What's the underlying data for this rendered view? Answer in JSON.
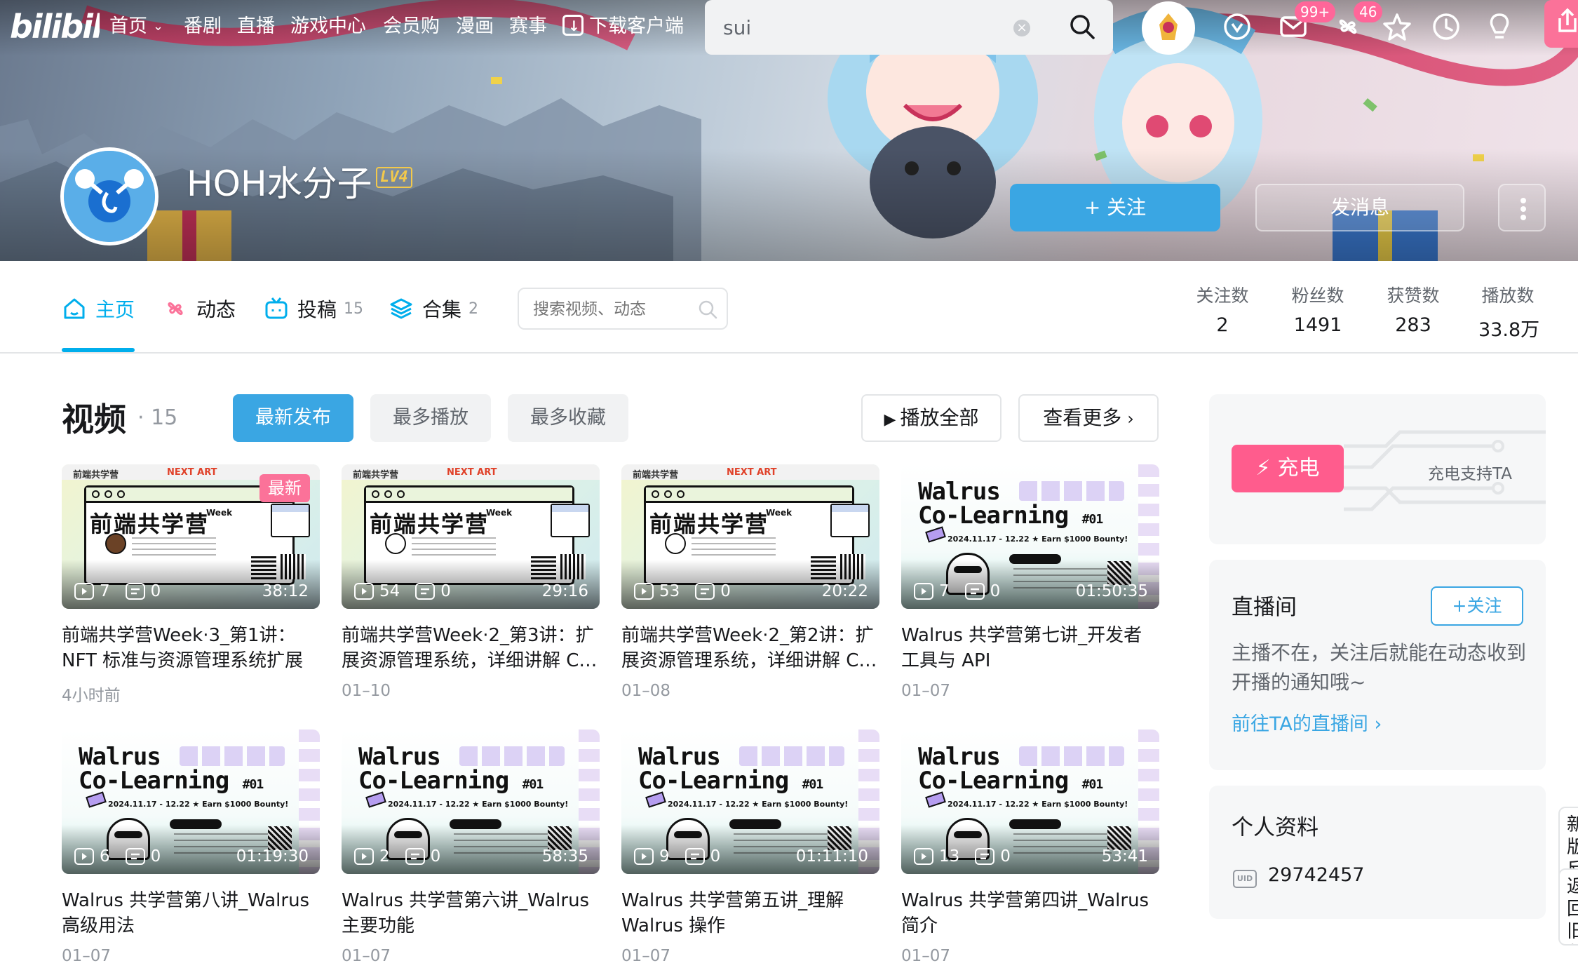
{
  "nav": {
    "logo": "bilibili",
    "items": [
      "首页",
      "番剧",
      "直播",
      "游戏中心",
      "会员购",
      "漫画",
      "赛事"
    ],
    "download": "下载客户端",
    "search_value": "sui",
    "badges": {
      "messages": "99+",
      "dynamic": "46"
    }
  },
  "profile": {
    "name": "HOH水分子",
    "level": "LV4",
    "follow_label": "+ 关注",
    "message_label": "发消息"
  },
  "tabs": {
    "home": "主页",
    "dynamic": "动态",
    "videos": "投稿",
    "videos_count": "15",
    "collections": "合集",
    "collections_count": "2",
    "search_placeholder": "搜索视频、动态"
  },
  "stats": [
    {
      "label": "关注数",
      "value": "2"
    },
    {
      "label": "粉丝数",
      "value": "1491"
    },
    {
      "label": "获赞数",
      "value": "283"
    },
    {
      "label": "播放数",
      "value": "33.8万"
    }
  ],
  "videos_section": {
    "title": "视频",
    "count": "· 15",
    "sort_latest": "最新发布",
    "sort_most_played": "最多播放",
    "sort_most_fav": "最多收藏",
    "play_all": "播放全部",
    "see_more": "查看更多"
  },
  "videos": [
    {
      "title": "前端共学营Week·3_第1讲：NFT 标准与资源管理系统扩展",
      "date": "4小时前",
      "plays": "7",
      "danmaku": "0",
      "duration": "38:12",
      "tag": "最新",
      "thumb_title": "前端共学营"
    },
    {
      "title": "前端共学营Week·2_第3讲：扩展资源管理系统，详细讲解 C…",
      "date": "01–10",
      "plays": "54",
      "danmaku": "0",
      "duration": "29:16",
      "thumb_title": "前端共学营"
    },
    {
      "title": "前端共学营Week·2_第2讲：扩展资源管理系统，详细讲解 C…",
      "date": "01–08",
      "plays": "53",
      "danmaku": "0",
      "duration": "20:22",
      "thumb_title": "前端共学营"
    },
    {
      "title": "Walrus 共学营第七讲_开发者工具与 API",
      "date": "01–07",
      "plays": "7",
      "danmaku": "0",
      "duration": "01:50:35",
      "thumb_title": "Walrus"
    },
    {
      "title": "Walrus 共学营第八讲_Walrus 高级用法",
      "date": "01–07",
      "plays": "6",
      "danmaku": "0",
      "duration": "01:19:30",
      "thumb_title": "Walrus"
    },
    {
      "title": "Walrus 共学营第六讲_Walrus 主要功能",
      "date": "01–07",
      "plays": "2",
      "danmaku": "0",
      "duration": "58:35",
      "thumb_title": "Walrus"
    },
    {
      "title": "Walrus 共学营第五讲_理解 Walrus 操作",
      "date": "01–07",
      "plays": "9",
      "danmaku": "0",
      "duration": "01:11:10",
      "thumb_title": "Walrus"
    },
    {
      "title": "Walrus 共学营第四讲_Walrus 简介",
      "date": "01–07",
      "plays": "13",
      "danmaku": "0",
      "duration": "53:41",
      "thumb_title": "Walrus"
    }
  ],
  "thumb_art": {
    "fe_header": "NEXT ART",
    "fe_week": "Week",
    "wl_line1": "Walrus",
    "wl_line2": "Co-Learning",
    "wl_num": "#01",
    "wl_date": "2024.11.17 - 12.22  ★ Earn $1000 Bounty!"
  },
  "sidebar": {
    "charge_label": "充电",
    "charge_text": "充电支持TA",
    "live_title": "直播间",
    "live_follow": "+关注",
    "live_desc": "主播不在，关注后就能在动态收到开播的通知哦~",
    "live_link": "前往TA的直播间  ›",
    "profile_title": "个人资料",
    "uid_icon": "UID",
    "uid": "29742457"
  },
  "float_tabs": [
    "新版反馈",
    "返回旧版"
  ],
  "colors": {
    "accent": "#00aeec",
    "button_blue": "#3aa6e3",
    "pink": "#fb7299"
  }
}
